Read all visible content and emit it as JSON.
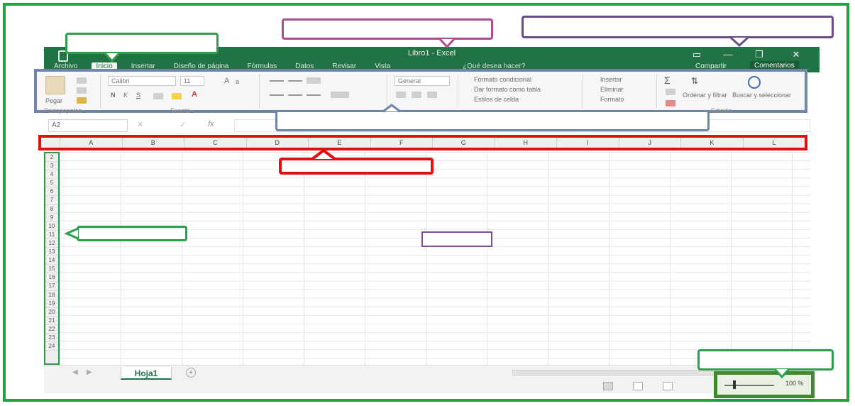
{
  "window": {
    "title": "Libro1 - Excel",
    "buttons": {
      "ribbon_options": "▭",
      "minimize": "—",
      "maximize": "❐",
      "close": "✕"
    }
  },
  "tabs": [
    "Archivo",
    "Inicio",
    "Insertar",
    "Diseño de página",
    "Fórmulas",
    "Datos",
    "Revisar",
    "Vista"
  ],
  "tell_me": "¿Qué desea hacer?",
  "share": "Compartir",
  "comments": "Comentarios",
  "ribbon": {
    "paste": "Pegar",
    "font_name": "Calibri",
    "font_size": "11",
    "font_buttons": [
      "N",
      "K",
      "S"
    ],
    "number_format": "General",
    "styles": [
      "Formato condicional",
      "Dar formato como tabla",
      "Estilos de celda"
    ],
    "cells": [
      "Insertar",
      "Eliminar",
      "Formato"
    ],
    "sort_filter": "Ordenar y filtrar",
    "find_select": "Buscar y seleccionar"
  },
  "group_labels": [
    "Portapapeles",
    "Fuente",
    "Edición"
  ],
  "formula_bar": {
    "name_box": "A2",
    "fx": "fx"
  },
  "columns": [
    "A",
    "B",
    "C",
    "D",
    "E",
    "F",
    "G",
    "H",
    "I",
    "J",
    "K",
    "L"
  ],
  "rows": [
    "2",
    "3",
    "4",
    "5",
    "6",
    "7",
    "8",
    "9",
    "10",
    "11",
    "12",
    "13",
    "14",
    "15",
    "16",
    "17",
    "18",
    "19",
    "20",
    "21",
    "22",
    "23",
    "24"
  ],
  "sheet_tab": "Hoja1",
  "add_sheet": "+",
  "zoom": "100 %",
  "colors": {
    "excel_green": "#217346",
    "frame_green": "#1fa23f",
    "highlight_red": "#e01010",
    "ribbon_border": "#6f86a6",
    "callout_pink": "#b04a8c",
    "callout_purple": "#6a4c8c",
    "zoom_green": "#3f8a2c"
  },
  "icons": [
    "app-icon",
    "paste-icon",
    "cut-icon",
    "copy-icon",
    "format-painter-icon",
    "autosum-icon",
    "sort-filter-icon",
    "search-icon"
  ]
}
